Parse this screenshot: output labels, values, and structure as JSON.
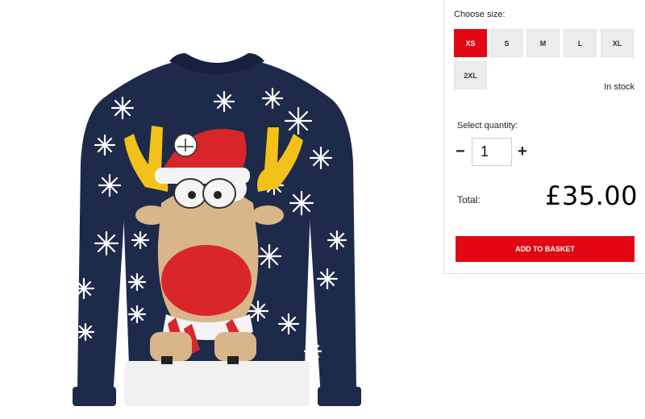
{
  "product": {
    "image_alt": "Reindeer Christmas jumper",
    "colors": {
      "navy": "#1e2a4a",
      "red": "#d9262a",
      "yellow": "#f2c21a",
      "tan": "#d8b68a",
      "white": "#f4f4f4"
    }
  },
  "size_selector": {
    "label": "Choose size:",
    "options": [
      {
        "label": "XS",
        "selected": true
      },
      {
        "label": "S",
        "selected": false
      },
      {
        "label": "M",
        "selected": false
      },
      {
        "label": "L",
        "selected": false
      },
      {
        "label": "XL",
        "selected": false
      },
      {
        "label": "2XL",
        "selected": false
      }
    ],
    "stock_status": "In stock"
  },
  "quantity": {
    "label": "Select quantity:",
    "minus": "−",
    "value": "1",
    "plus": "+"
  },
  "total": {
    "label": "Total:",
    "price": "£35.00"
  },
  "actions": {
    "add_to_basket": "ADD TO BASKET"
  },
  "theme": {
    "accent": "#e30613",
    "size_bg": "#ececec"
  }
}
